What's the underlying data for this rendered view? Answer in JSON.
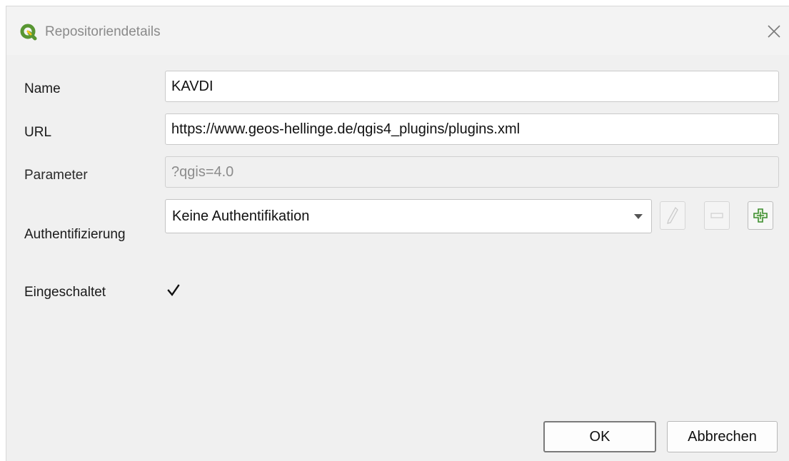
{
  "window": {
    "title": "Repositoriendetails",
    "icon": "qgis-logo-icon"
  },
  "form": {
    "name": {
      "label": "Name",
      "value": "KAVDI"
    },
    "url": {
      "label": "URL",
      "value": "https://www.geos-hellinge.de/qgis4_plugins/plugins.xml"
    },
    "parameter": {
      "label": "Parameter",
      "value": "?qgis=4.0",
      "disabled": true
    },
    "authentication": {
      "label": "Authentifizierung",
      "selected": "Keine Authentifikation",
      "buttons": [
        "edit-pencil-icon",
        "remove-minus-icon",
        "add-plus-icon"
      ]
    },
    "enabled": {
      "label": "Eingeschaltet",
      "checked": true
    }
  },
  "buttons": {
    "ok": "OK",
    "cancel": "Abbrechen"
  },
  "colors": {
    "accent_green": "#589632",
    "background": "#f0f0f0"
  }
}
